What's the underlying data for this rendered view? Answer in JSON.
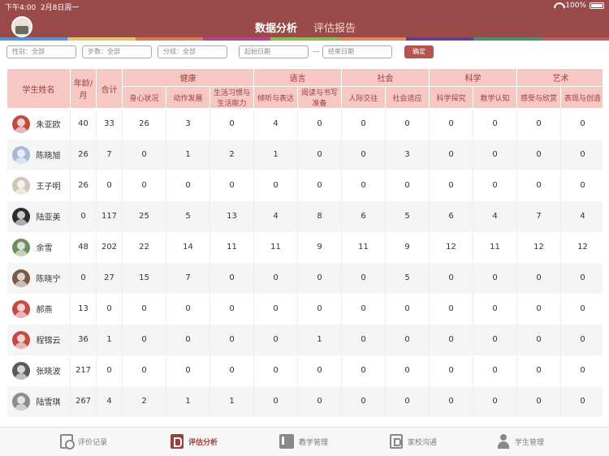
{
  "status": {
    "time": "下午4:00",
    "date": "2月8日周一",
    "battery": "100%"
  },
  "header": {
    "tabs": [
      {
        "label": "数据分析",
        "active": true
      },
      {
        "label": "评估报告",
        "active": false
      }
    ],
    "colors": {
      "bar": "#9a4a48",
      "accent": "#b35450"
    },
    "stripe_colors": [
      "#5a8fd0",
      "#e6c26b",
      "#d87a57",
      "#b5448b",
      "#8fb856",
      "#e3875e",
      "#6a3d89",
      "#4f8e6a",
      "#c15a5a"
    ]
  },
  "filters": {
    "gender": "性别：全部",
    "age": "岁数：全部",
    "group": "分组：全部",
    "start_date": "起始日期",
    "separator": "—",
    "end_date": "结束日期",
    "confirm": "确定"
  },
  "table": {
    "headers": {
      "name": "学生姓名",
      "age": "年龄/月",
      "total": "合计",
      "groups": [
        "健康",
        "语言",
        "社会",
        "科学",
        "艺术"
      ],
      "subs": [
        "身心状况",
        "动作发展",
        "生活习惯与生活能力",
        "倾听与表达",
        "阅读与书写准备",
        "人际交往",
        "社会适应",
        "科学探究",
        "数学认知",
        "感受与欣赏",
        "表现与创造"
      ]
    },
    "rows": [
      {
        "name": "朱亚欧",
        "avatar": "#c24b43",
        "values": [
          "40",
          "33",
          "26",
          "3",
          "0",
          "4",
          "0",
          "0",
          "0",
          "0",
          "0",
          "0",
          "0"
        ]
      },
      {
        "name": "陈晓旭",
        "avatar": "#a9b9d6",
        "values": [
          "26",
          "7",
          "0",
          "1",
          "2",
          "1",
          "0",
          "0",
          "3",
          "0",
          "0",
          "0",
          "0"
        ]
      },
      {
        "name": "王子明",
        "avatar": "#cfc6b5",
        "values": [
          "26",
          "0",
          "0",
          "0",
          "0",
          "0",
          "0",
          "0",
          "0",
          "0",
          "0",
          "0",
          "0"
        ]
      },
      {
        "name": "陆亚美",
        "avatar": "#2e2e2e",
        "values": [
          "0",
          "117",
          "25",
          "5",
          "13",
          "4",
          "8",
          "6",
          "5",
          "6",
          "4",
          "7",
          "4"
        ]
      },
      {
        "name": "余雪",
        "avatar": "#6f8f5e",
        "values": [
          "48",
          "202",
          "22",
          "14",
          "11",
          "11",
          "9",
          "11",
          "9",
          "12",
          "11",
          "12",
          "12"
        ]
      },
      {
        "name": "陈晓宁",
        "avatar": "#7a5a43",
        "values": [
          "0",
          "27",
          "15",
          "7",
          "0",
          "0",
          "0",
          "0",
          "5",
          "0",
          "0",
          "0",
          "0"
        ]
      },
      {
        "name": "郝燕",
        "avatar": "#c24b43",
        "values": [
          "13",
          "0",
          "0",
          "0",
          "0",
          "0",
          "0",
          "0",
          "0",
          "0",
          "0",
          "0",
          "0"
        ]
      },
      {
        "name": "程锦云",
        "avatar": "#c24b43",
        "values": [
          "36",
          "1",
          "0",
          "0",
          "0",
          "0",
          "1",
          "0",
          "0",
          "0",
          "0",
          "0",
          "0"
        ]
      },
      {
        "name": "张晓波",
        "avatar": "#5a5a5a",
        "values": [
          "217",
          "0",
          "0",
          "0",
          "0",
          "0",
          "0",
          "0",
          "0",
          "0",
          "0",
          "0",
          "0"
        ]
      },
      {
        "name": "陆雪琪",
        "avatar": "#8a8f8a",
        "values": [
          "267",
          "4",
          "2",
          "1",
          "1",
          "0",
          "0",
          "0",
          "0",
          "0",
          "0",
          "0",
          "0"
        ]
      }
    ]
  },
  "bottom_nav": [
    {
      "label": "评价记录",
      "icon": "record-icon",
      "active": false
    },
    {
      "label": "评估分析",
      "icon": "analysis-icon",
      "active": true
    },
    {
      "label": "教学管理",
      "icon": "teaching-icon",
      "active": false
    },
    {
      "label": "家校沟通",
      "icon": "communication-icon",
      "active": false
    },
    {
      "label": "学生管理",
      "icon": "student-icon",
      "active": false
    }
  ]
}
